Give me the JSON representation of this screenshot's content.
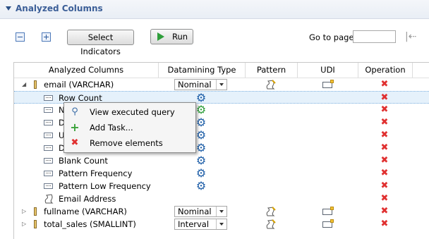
{
  "section": {
    "title": "Analyzed Columns"
  },
  "toolbar": {
    "select_indicators": "Select Indicators",
    "run": "Run",
    "goto_label": "Go to page",
    "goto_value": ""
  },
  "table": {
    "headers": [
      "Analyzed Columns",
      "Datamining Type",
      "Pattern",
      "UDI",
      "Operation"
    ],
    "rows": [
      {
        "label": "email (VARCHAR)",
        "datamining": "Nominal"
      },
      {
        "label": "Row Count"
      },
      {
        "label": "N"
      },
      {
        "label": "D"
      },
      {
        "label": "U"
      },
      {
        "label": "D"
      },
      {
        "label": "Blank Count"
      },
      {
        "label": "Pattern Frequency"
      },
      {
        "label": "Pattern Low Frequency"
      },
      {
        "label": "Email Address"
      },
      {
        "label": "fullname (VARCHAR)",
        "datamining": "Nominal"
      },
      {
        "label": "total_sales (SMALLINT)",
        "datamining": "Interval"
      }
    ]
  },
  "context_menu": {
    "items": [
      {
        "label": "View executed query",
        "icon": "magnifier-icon"
      },
      {
        "label": "Add Task...",
        "icon": "add-icon"
      },
      {
        "label": "Remove elements",
        "icon": "delete-icon"
      }
    ]
  },
  "colors": {
    "accent": "#3b5e97",
    "delete": "#e03030",
    "gear": "#1f5fa8",
    "selection": "#e5f1fb"
  }
}
